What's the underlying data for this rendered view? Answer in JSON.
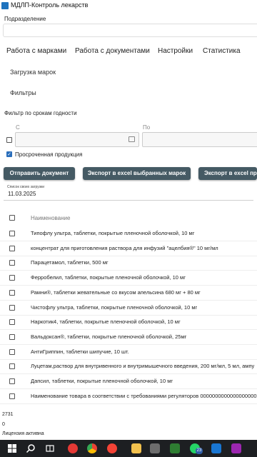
{
  "window": {
    "title": "МДЛП-Контроль лекарств"
  },
  "subdivision": {
    "label": "Подразделение",
    "value": ""
  },
  "tabs": [
    "Работа с марками",
    "Работа с документами",
    "Настройки",
    "Статистика"
  ],
  "sections": {
    "upload_marks": "Загрузка марок",
    "filters": "Фильтры"
  },
  "expiry_filter": {
    "title": "Фильтр по срокам годности",
    "from_label": "С",
    "to_label": "По",
    "expired_label": "Просроченная продукция",
    "expired_checked": true
  },
  "buttons": {
    "send_doc": "Отправить документ",
    "export_selected": "Экспорт в excel выбранных марок",
    "export_all": "Экспорт в excel пр"
  },
  "uploads": {
    "label": "Список своих загрузки",
    "selected": "11.03.2025"
  },
  "table": {
    "header": "Наименование",
    "rows": [
      "Типофлу ультра, таблетки, покрытые пленочной оболочкой, 10 мг",
      "концентрат для приготовления раствора для инфузий \"ацелбия®\" 10 мг/мл",
      "Парацетамол, таблетки, 500 мг",
      "Ферробелил, таблетки, покрытые пленочной оболочкой, 10 мг",
      "Рамни®, таблетки жевательные со вкусом апельсина 680 мг + 80 мг",
      "Чистофлу ультра, таблетки, покрытые пленочной оболочкой, 10 мг",
      "Наркотик4, таблетки, покрытые пленочной оболочкой, 10 мг",
      "Вальдоксан®, таблетки, покрытые пленочной оболочкой, 25мг",
      "АнтиГриппин, таблетки шипучие, 10 шт.",
      "Луцетам,раствор для внутривенного и внутримышечного введения, 200 мг/мл, 5 мл, ампу",
      "Дапсил, таблетки, покрытые пленочной оболочкой, 10 мг",
      "Наименование товара в соответствии с требованиями регуляторов 0000000000000000000"
    ]
  },
  "footer": {
    "count": "2731",
    "zero": "0",
    "license": "Лицензия активна"
  },
  "taskbar": {
    "badge": "23",
    "icons": [
      "windows-icon",
      "search-icon",
      "task-view-icon",
      "yandex-browser-icon",
      "chrome-icon",
      "yandex-disk-icon",
      "file-explorer-icon",
      "calculator-icon",
      "app-icon",
      "whatsapp-icon",
      "mail-icon",
      "photos-icon"
    ]
  },
  "colors": {
    "button": "#455a64",
    "taskbar": "#1d1f22",
    "accent": "#2a6ebb"
  }
}
